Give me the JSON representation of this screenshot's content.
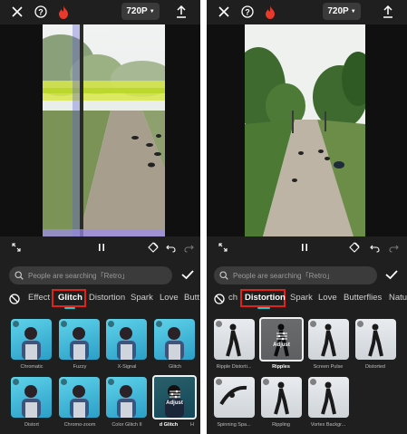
{
  "colors": {
    "accent": "#1fc8c8",
    "highlight_box": "#e0221b",
    "background": "#1f1f1f"
  },
  "left": {
    "topbar": {
      "close_icon": "close-icon",
      "help_icon": "help-icon",
      "fire_icon": "fire-icon",
      "resolution": "720P",
      "export_icon": "export-icon"
    },
    "search_placeholder": "People are searching「Retro」",
    "tabs": [
      "Effect",
      "Glitch",
      "Distortion",
      "Spark",
      "Love",
      "Butt"
    ],
    "active_tab": "Glitch",
    "items": [
      {
        "label": "Chromatic"
      },
      {
        "label": "Fuzzy"
      },
      {
        "label": "X-Signal"
      },
      {
        "label": "Glitch"
      },
      {
        "label": "Distort"
      },
      {
        "label": "Chromo-zoom"
      },
      {
        "label": "Color Glitch II"
      },
      {
        "label": "d Glitch"
      },
      {
        "label": "H"
      }
    ],
    "adjust_label": "Adjust"
  },
  "right": {
    "topbar": {
      "resolution": "720P"
    },
    "search_placeholder": "People are searching「Retro」",
    "tabs": [
      "ch",
      "Distortion",
      "Spark",
      "Love",
      "Butterflies",
      "Natu"
    ],
    "active_tab": "Distortion",
    "items": [
      {
        "label": "Ripple Distorti..."
      },
      {
        "label": "Ripples"
      },
      {
        "label": "Screen Pulse"
      },
      {
        "label": "Distorted"
      },
      {
        "label": "Spinning Spa..."
      },
      {
        "label": "Rippling"
      },
      {
        "label": "Vortex Backgr..."
      }
    ],
    "adjust_label": "Adjust"
  }
}
